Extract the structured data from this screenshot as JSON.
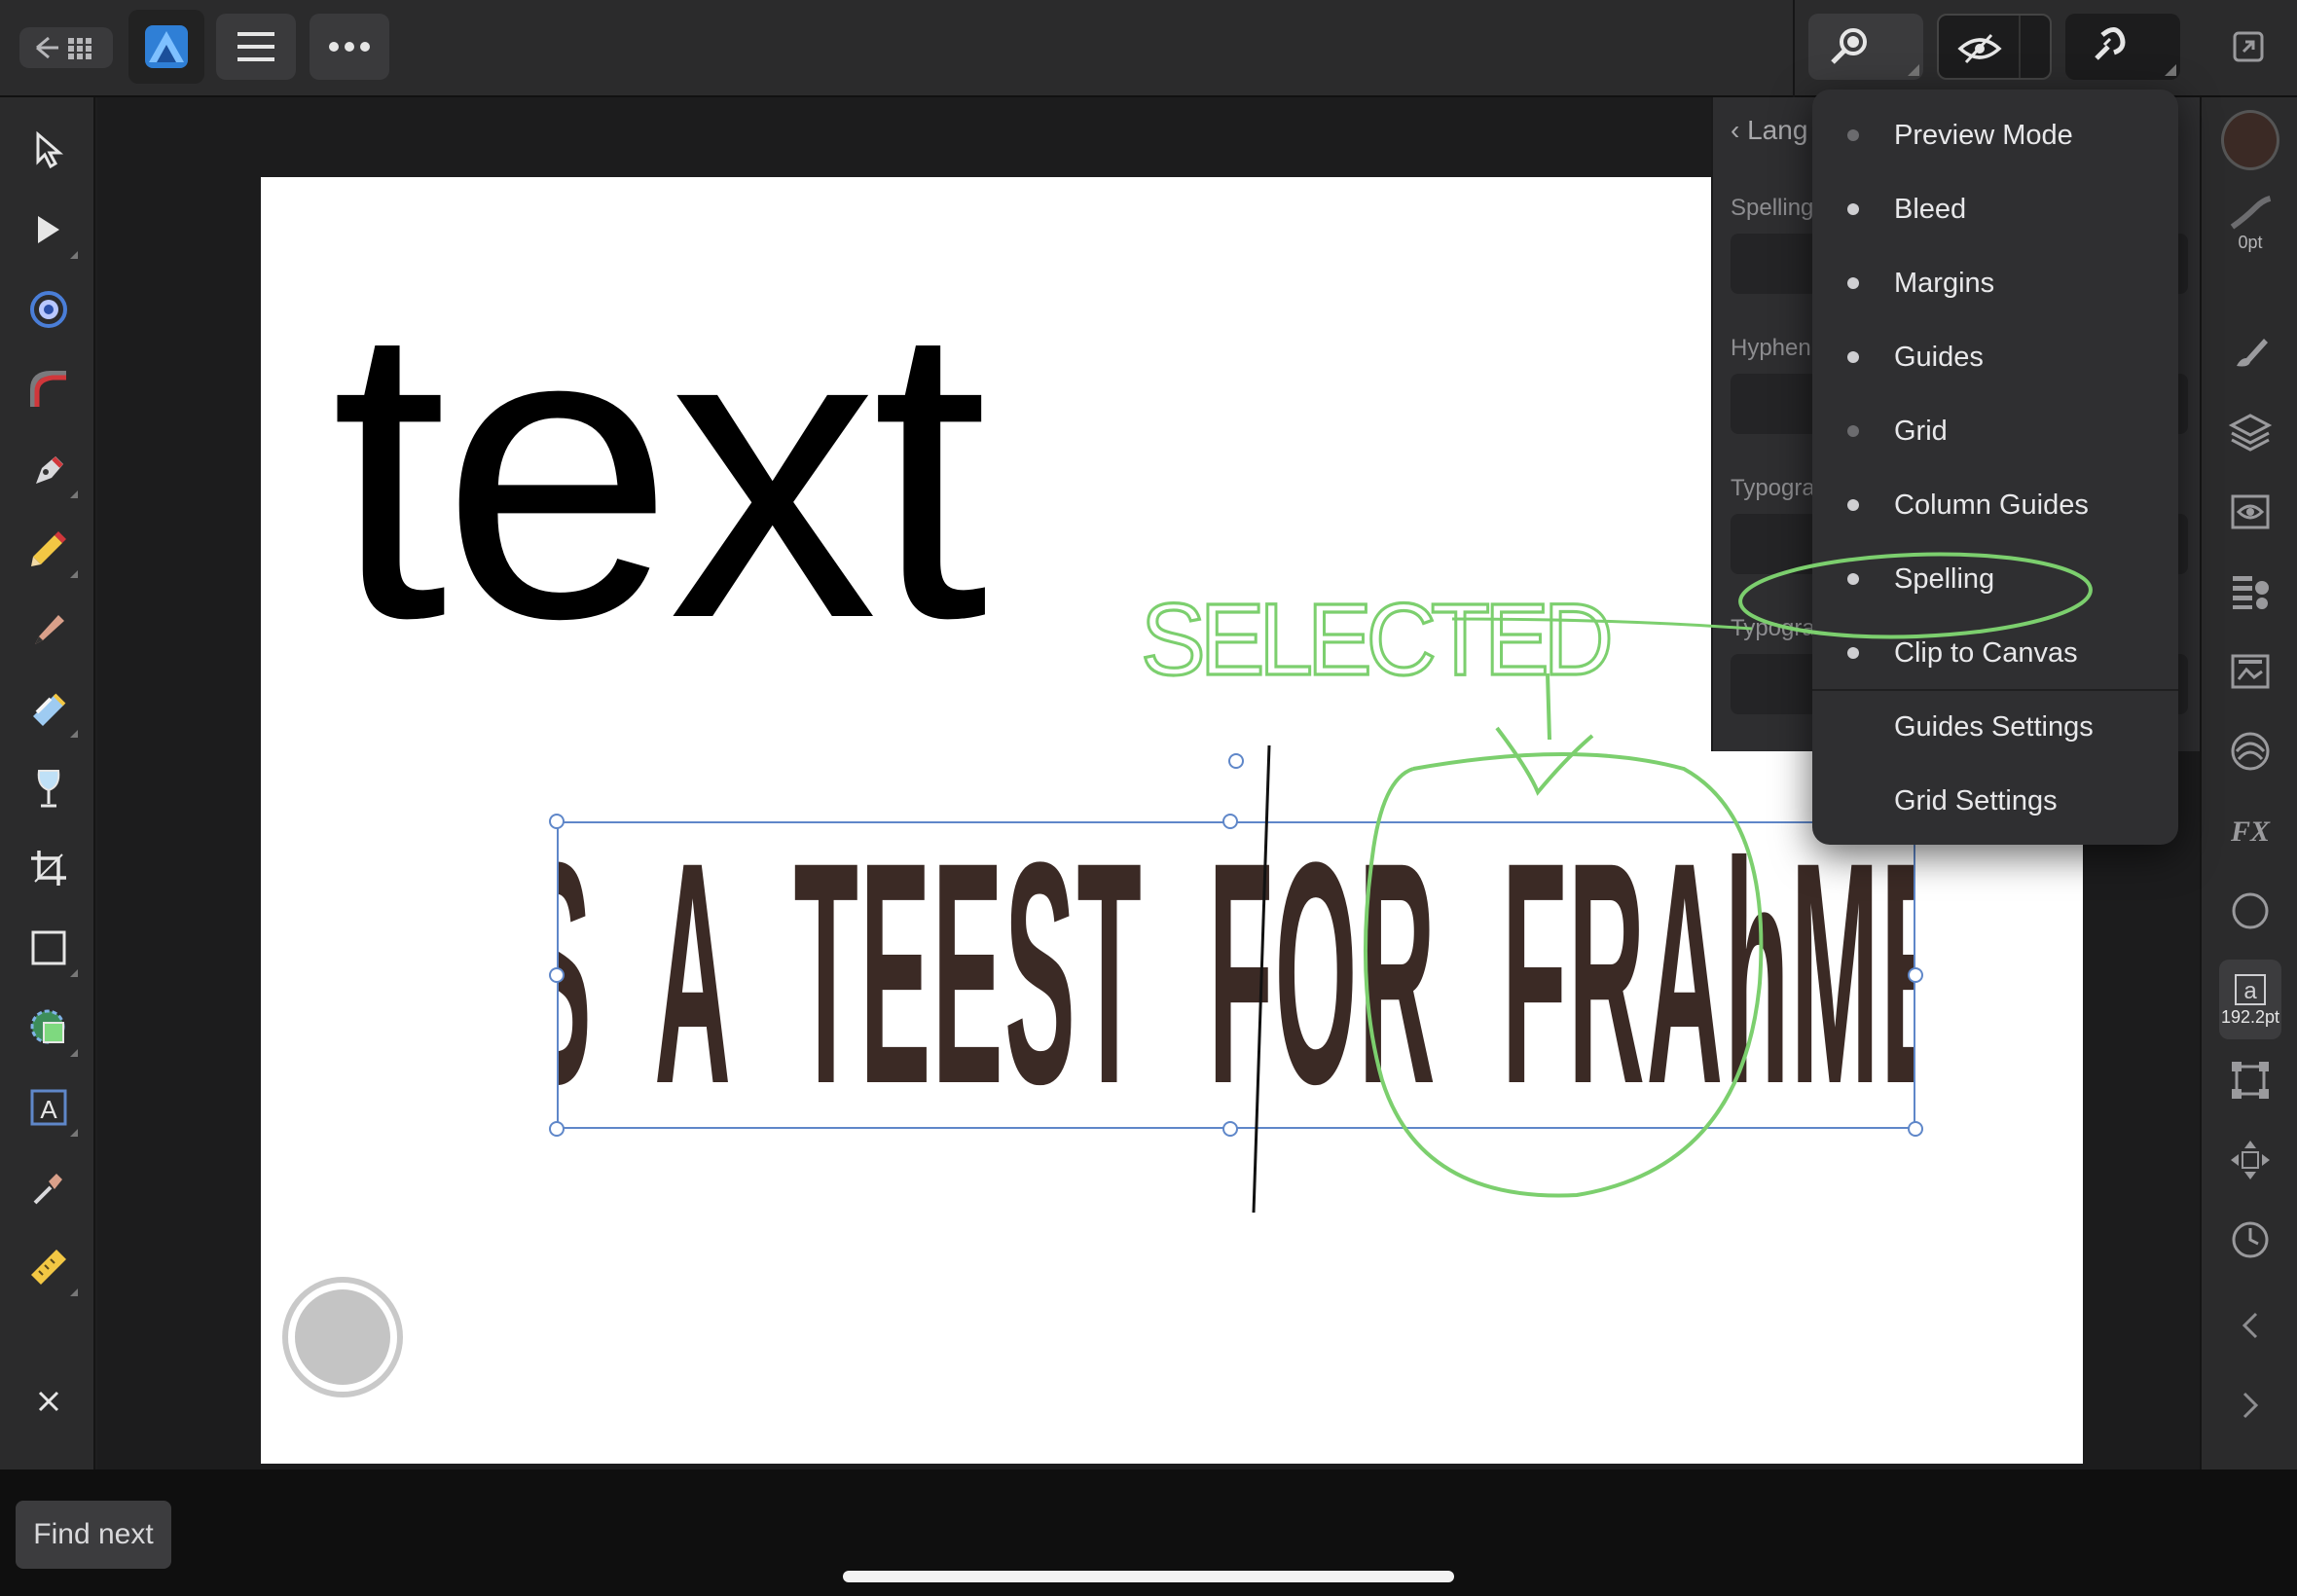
{
  "top_bar": {
    "back_grid_button": "back-to-documents",
    "app_icon": "affinity-publisher-icon",
    "menu_icon": "hamburger-icon",
    "more_icon": "more-icon",
    "zoom_icon": "zoom-icon",
    "view_icon": "eye-icon",
    "snapping_icon": "magnet-icon",
    "expand_icon": "expand-icon"
  },
  "canvas": {
    "big_text": "text",
    "frame_text": "THIS IS A TEEST FOR FRAhME TEXT",
    "annotation_text": "SELECTED"
  },
  "language_panel": {
    "title": "Lang",
    "labels": [
      "Spelling",
      "Hyphen",
      "Typogra",
      "Typogra"
    ]
  },
  "view_menu": {
    "items": [
      {
        "label": "Preview Mode",
        "dot": "dim"
      },
      {
        "label": "Bleed",
        "dot": "on"
      },
      {
        "label": "Margins",
        "dot": "on"
      },
      {
        "label": "Guides",
        "dot": "on"
      },
      {
        "label": "Grid",
        "dot": "dim"
      },
      {
        "label": "Column Guides",
        "dot": "on"
      },
      {
        "label": "Spelling",
        "dot": "on"
      },
      {
        "label": "Clip to Canvas",
        "dot": "on"
      }
    ],
    "settings": [
      "Guides Settings",
      "Grid Settings"
    ]
  },
  "right_panel": {
    "stroke_width": "0pt",
    "font_size": "192.2pt"
  },
  "bottom": {
    "find_next": "Find next"
  },
  "colors": {
    "accent": "#5f87c9",
    "annotation": "#7ccf6e",
    "text_brown": "#3b2a25"
  }
}
